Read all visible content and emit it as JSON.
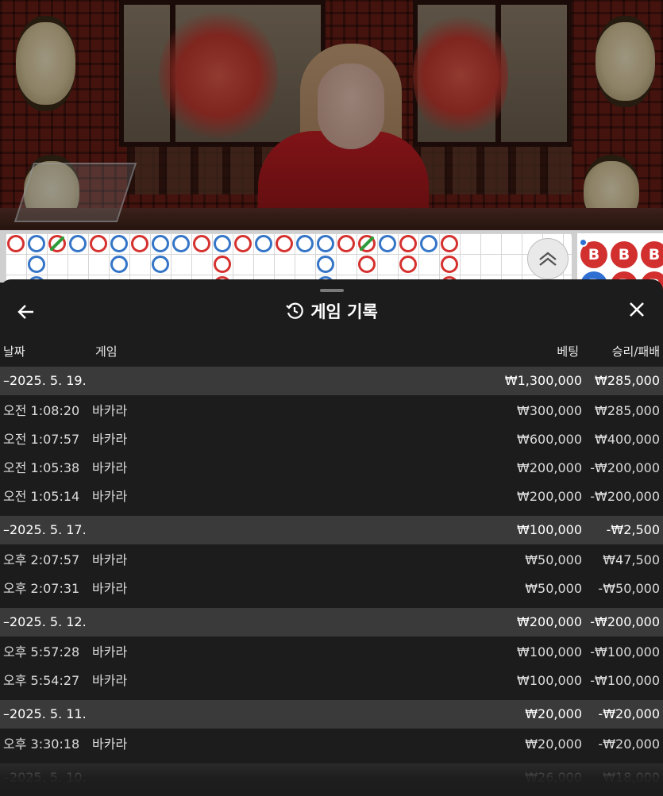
{
  "header": {
    "title": "게임 기록",
    "back_icon": "arrow-left-icon",
    "history_icon": "history-clock-icon",
    "close_icon": "close-icon"
  },
  "columns": {
    "date": "날짜",
    "game": "게임",
    "bet": "베팅",
    "win_loss": "승리/패배"
  },
  "groups": [
    {
      "date": "–2025. 5. 19.",
      "bet": "₩1,300,000",
      "result": "₩285,000",
      "entries": [
        {
          "time": "오전 1:08:20",
          "game": "바카라",
          "bet": "₩300,000",
          "result": "₩285,000"
        },
        {
          "time": "오전 1:07:57",
          "game": "바카라",
          "bet": "₩600,000",
          "result": "₩400,000"
        },
        {
          "time": "오전 1:05:38",
          "game": "바카라",
          "bet": "₩200,000",
          "result": "-₩200,000"
        },
        {
          "time": "오전 1:05:14",
          "game": "바카라",
          "bet": "₩200,000",
          "result": "-₩200,000"
        }
      ]
    },
    {
      "date": "–2025. 5. 17.",
      "bet": "₩100,000",
      "result": "-₩2,500",
      "entries": [
        {
          "time": "오후 2:07:57",
          "game": "바카라",
          "bet": "₩50,000",
          "result": "₩47,500"
        },
        {
          "time": "오후 2:07:31",
          "game": "바카라",
          "bet": "₩50,000",
          "result": "-₩50,000"
        }
      ]
    },
    {
      "date": "–2025. 5. 12.",
      "bet": "₩200,000",
      "result": "-₩200,000",
      "entries": [
        {
          "time": "오후 5:57:28",
          "game": "바카라",
          "bet": "₩100,000",
          "result": "-₩100,000"
        },
        {
          "time": "오후 5:54:27",
          "game": "바카라",
          "bet": "₩100,000",
          "result": "-₩100,000"
        }
      ]
    },
    {
      "date": "–2025. 5. 11.",
      "bet": "₩20,000",
      "result": "-₩20,000",
      "entries": [
        {
          "time": "오후 3:30:18",
          "game": "바카라",
          "bet": "₩20,000",
          "result": "-₩20,000"
        }
      ]
    },
    {
      "date": "–2025. 5. 10.",
      "bet": "₩26,000",
      "result": "₩18,000",
      "entries": []
    }
  ],
  "roadmap": {
    "big_road_labels": [
      "B",
      "B",
      "B",
      "P",
      "B",
      "B"
    ],
    "scroll_icon": "double-chevron-up-icon",
    "colors": {
      "banker": "#d5322f",
      "player": "#3575c7",
      "tie": "#2e9b3a"
    }
  }
}
